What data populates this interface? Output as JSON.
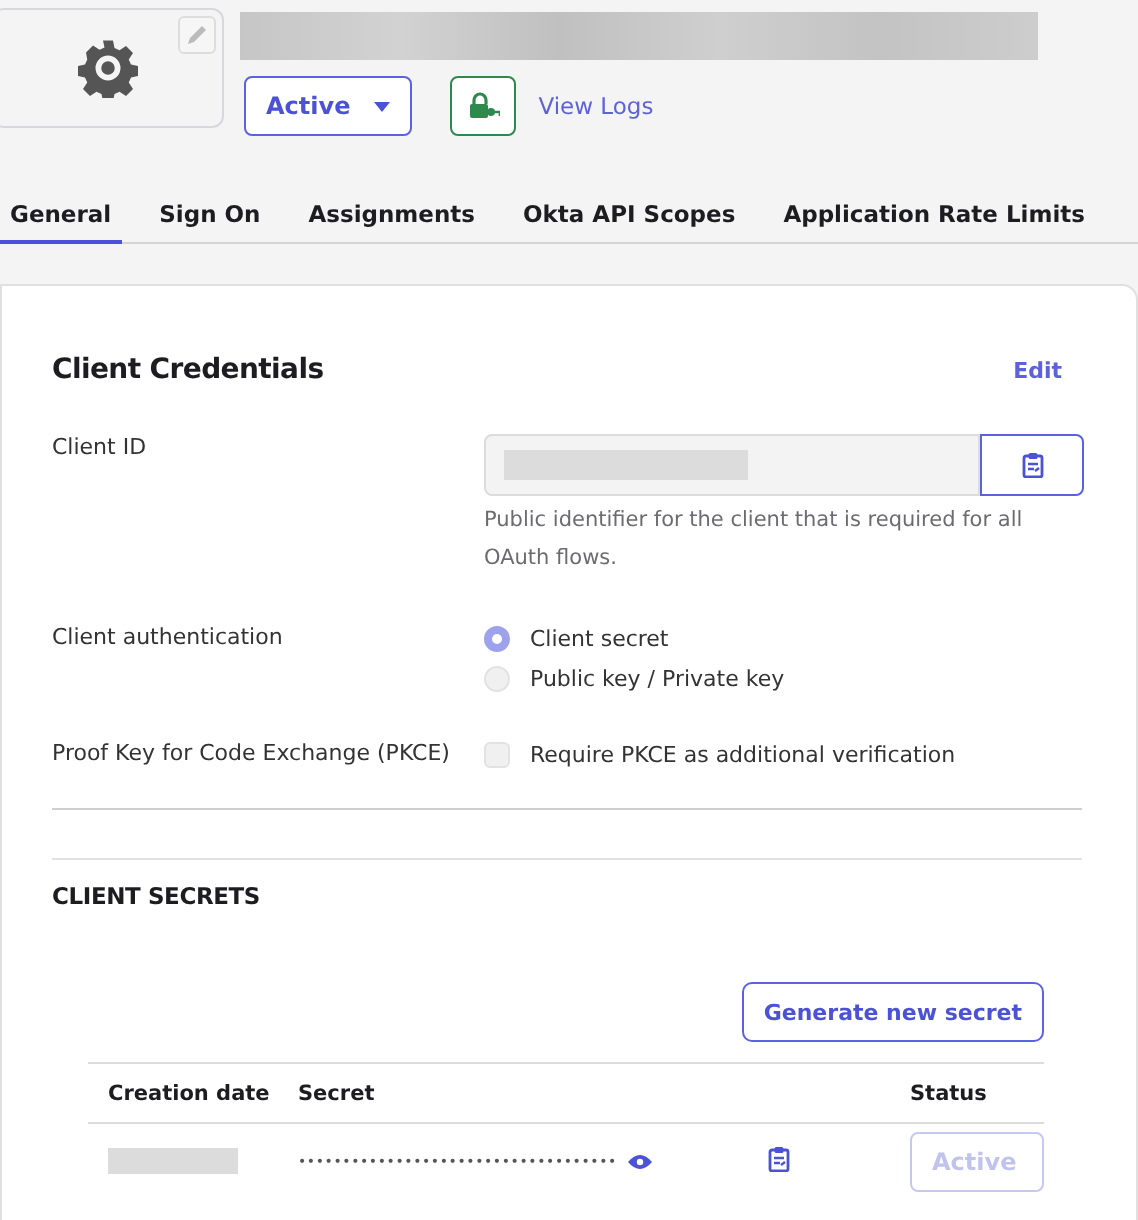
{
  "header": {
    "status_button": {
      "label": "Active"
    },
    "view_logs": "View Logs"
  },
  "tabs": [
    {
      "label": "General",
      "selected": true
    },
    {
      "label": "Sign On",
      "selected": false
    },
    {
      "label": "Assignments",
      "selected": false
    },
    {
      "label": "Okta API Scopes",
      "selected": false
    },
    {
      "label": "Application Rate Limits",
      "selected": false
    }
  ],
  "credentials": {
    "title": "Client Credentials",
    "edit": "Edit",
    "client_id": {
      "label": "Client ID",
      "help": "Public identifier for the client that is required for all OAuth flows."
    },
    "client_authentication": {
      "label": "Client authentication",
      "options": [
        {
          "label": "Client secret",
          "selected": true
        },
        {
          "label": "Public key / Private key",
          "selected": false
        }
      ]
    },
    "pkce": {
      "label": "Proof Key for Code Exchange (PKCE)",
      "option": "Require PKCE as additional verification",
      "checked": false
    }
  },
  "client_secrets": {
    "title": "CLIENT SECRETS",
    "generate_button": "Generate new secret",
    "columns": [
      "Creation date",
      "Secret",
      "Status"
    ],
    "rows": [
      {
        "secret": "••••••••••••••••••••••••••••••••••••",
        "status": "Active",
        "disabled": true
      }
    ]
  }
}
